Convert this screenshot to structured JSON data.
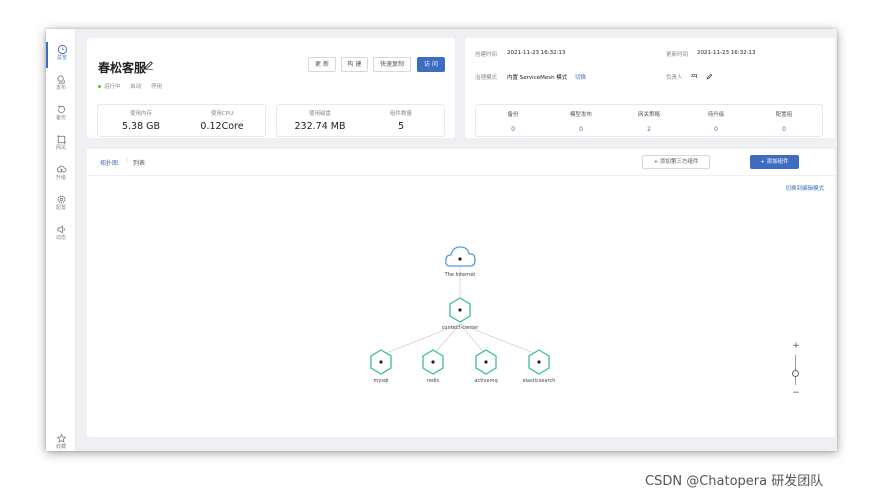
{
  "sidebar": {
    "items": [
      {
        "label": "总览",
        "icon": "dashboard-icon"
      },
      {
        "label": "发布",
        "icon": "publish-icon"
      },
      {
        "label": "备份",
        "icon": "backup-icon"
      },
      {
        "label": "网关",
        "icon": "gateway-icon"
      },
      {
        "label": "升级",
        "icon": "upgrade-icon"
      },
      {
        "label": "配置",
        "icon": "config-icon"
      },
      {
        "label": "动态",
        "icon": "activity-icon"
      }
    ],
    "bottom": {
      "label": "收藏",
      "icon": "star-icon"
    }
  },
  "app": {
    "name": "春松客服",
    "buttons": {
      "update": "更 新",
      "build": "构 建",
      "copy": "快速复制",
      "visit": "访 问"
    },
    "status": {
      "running": "运行中",
      "start": "启动",
      "stop": "停用"
    },
    "stats": [
      {
        "label": "使用内存",
        "value": "5.38 GB"
      },
      {
        "label": "使用CPU",
        "value": "0.12Core"
      },
      {
        "label": "使用磁盘",
        "value": "232.74 MB"
      },
      {
        "label": "组件数量",
        "value": "5"
      }
    ]
  },
  "meta": {
    "created_label": "创建时间",
    "created_value": "2021-11-23 16:32:13",
    "updated_label": "更新时间",
    "updated_value": "2021-11-23 16:32:13",
    "governance_label": "治理模式",
    "governance_value": "内置 ServiceMesh 模式",
    "governance_switch": "切换",
    "owner_label": "负责人",
    "owner_value": "zq",
    "stats": [
      {
        "label": "备份",
        "value": "0"
      },
      {
        "label": "模型发布",
        "value": "0"
      },
      {
        "label": "网关策略",
        "value": "2"
      },
      {
        "label": "待升级",
        "value": "0"
      },
      {
        "label": "配置组",
        "value": "0"
      }
    ]
  },
  "topology": {
    "tabs": {
      "topology": "拓扑图",
      "list": "列表"
    },
    "add_third_party": "添加第三方组件",
    "add_component": "添加组件",
    "switch_edit": "切换到编辑模式",
    "nodes": {
      "internet": "The Internet",
      "center": "contact-center",
      "mysql": "mysql",
      "redis": "redis",
      "activemq": "activemq",
      "elasticsearch": "elasticsearch"
    },
    "zoom": {
      "plus": "+",
      "minus": "−",
      "level": 0.4
    }
  },
  "watermark": "CSDN @Chatopera 研发团队",
  "colors": {
    "accent": "#3d6cc0",
    "node": "#3bc18a",
    "cloud": "#5b9bd5",
    "running": "#52c41a"
  }
}
